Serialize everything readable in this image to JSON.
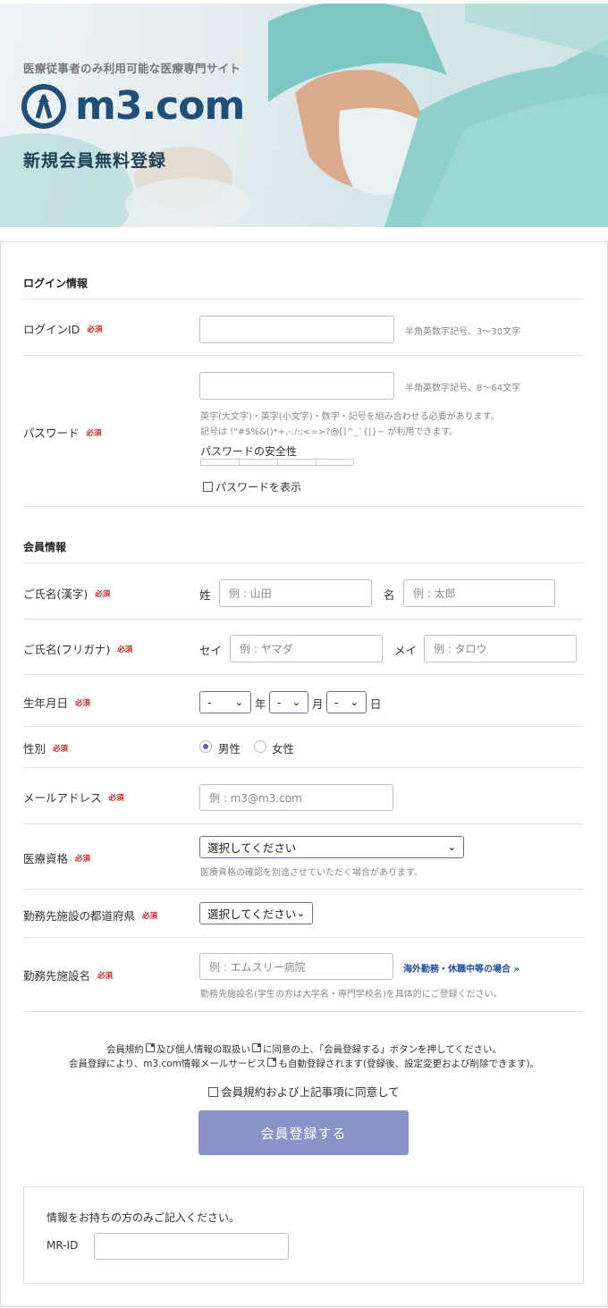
{
  "header": {
    "tagline": "医療従事者のみ利用可能な医療専門サイト",
    "logo_text": "m3.com",
    "subtitle": "新規会員無料登録"
  },
  "required_mark": "必須",
  "login_section": {
    "title": "ログイン情報",
    "login_id": {
      "label": "ログインID",
      "value": "",
      "hint": "半角英数字記号、3〜30文字"
    },
    "password": {
      "label": "パスワード",
      "value": "",
      "hint": "半角英数字記号、8〜64文字",
      "note1": "英字(大文字)・英字(小文字)・数字・記号を組み合わせる必要があります。",
      "note2": "記号は !\"#$%&()*+,-./:;<=>?@[]^_`{|}~ が利用できます。",
      "strength_label": "パスワードの安全性",
      "show_label": "パスワードを表示"
    }
  },
  "member_section": {
    "title": "会員情報",
    "name_kanji": {
      "label": "ご氏名(漢字)",
      "last_label": "姓",
      "last_placeholder": "例 : 山田",
      "first_label": "名",
      "first_placeholder": "例 : 太郎"
    },
    "name_kana": {
      "label": "ご氏名(フリガナ)",
      "last_label": "セイ",
      "last_placeholder": "例 : ヤマダ",
      "first_label": "メイ",
      "first_placeholder": "例 : タロウ"
    },
    "birth": {
      "label": "生年月日",
      "year_value": "-",
      "year_unit": "年",
      "month_value": "-",
      "month_unit": "月",
      "day_value": "-",
      "day_unit": "日"
    },
    "gender": {
      "label": "性別",
      "male": "男性",
      "female": "女性",
      "selected": "男性"
    },
    "email": {
      "label": "メールアドレス",
      "placeholder": "例 : m3@m3.com"
    },
    "qualification": {
      "label": "医療資格",
      "value": "選択してください",
      "note": "医療資格の確認を別途させていただく場合があります。"
    },
    "prefecture": {
      "label": "勤務先施設の都道府県",
      "value": "選択してください"
    },
    "facility": {
      "label": "勤務先施設名",
      "placeholder": "例 : エムスリー病院",
      "overseas_link": "海外勤務・休職中等の場合",
      "note": "勤務先施設名(学生の方は大学名・専門学校名)を具体的にご登録ください。"
    }
  },
  "agreement": {
    "line1_a": "会員規約",
    "line1_b": "及び個人情報の取扱い",
    "line1_c": "に同意の上、「会員登録する」ボタンを押してください。",
    "line2_a": "会員登録により、m3.com情報メールサービス",
    "line2_b": "も自動登録されます(登録後、設定変更および削除できます)。",
    "checkbox_label": "会員規約および上記事項に同意して",
    "submit_label": "会員登録する"
  },
  "mr": {
    "note": "情報をお持ちの方のみご記入ください。",
    "label": "MR-ID",
    "value": ""
  }
}
